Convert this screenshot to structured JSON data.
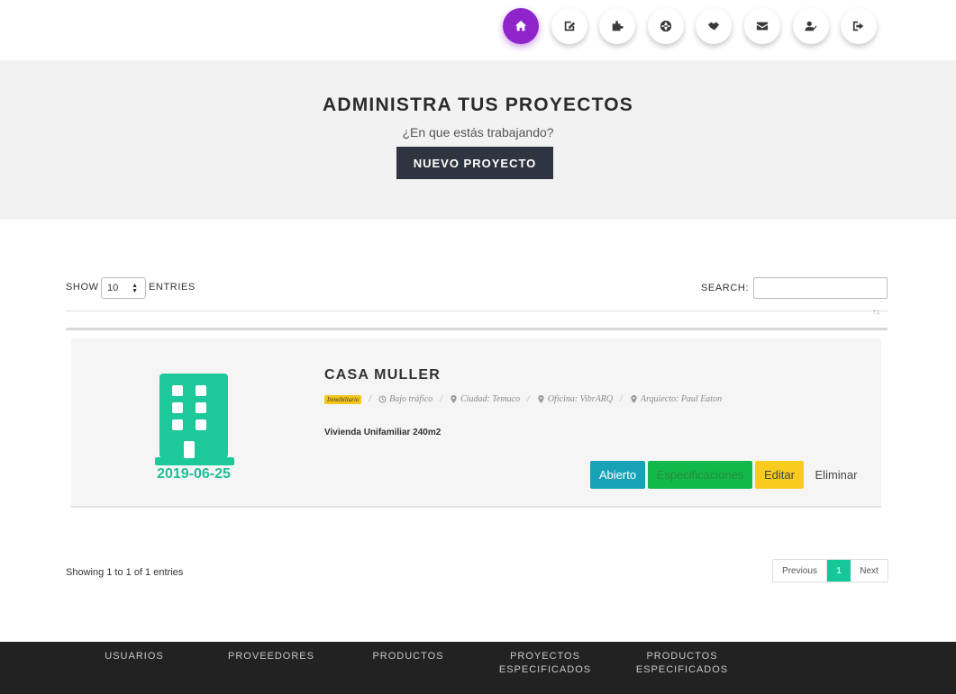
{
  "nav": {
    "icons": [
      "home-icon",
      "edit-icon",
      "puzzle-icon",
      "globe-icon",
      "handshake-icon",
      "envelope-icon",
      "user-check-icon",
      "sign-out-icon"
    ],
    "active_color": "#8e24c9"
  },
  "hero": {
    "title": "ADMINISTRA TUS PROYECTOS",
    "subtitle": "¿En que estás trabajando?",
    "button_label": "NUEVO PROYECTO"
  },
  "table": {
    "show_label": "SHOW",
    "entries_label": "ENTRIES",
    "page_length": "10",
    "search_label": "SEARCH:",
    "search_value": "",
    "sort_indicator": "↑↓"
  },
  "project": {
    "date": "2019-06-25",
    "title": "CASA MULLER",
    "category": "Inmobiliario",
    "traffic": "Bajo tráfico",
    "city": "Ciudad: Temuco",
    "office": "Oficina: VibrARQ",
    "architect": "Arquiecto: Paul Eaton",
    "description": "Vivienda Unifamiliar 240m2",
    "actions": {
      "open": "Abierto",
      "specs": "Especificaciones",
      "edit": "Editar",
      "delete": "Eliminar"
    },
    "icon_color": "#1bc99b"
  },
  "pagination": {
    "info": "Showing 1 to 1 of 1 entries",
    "previous": "Previous",
    "current": "1",
    "next": "Next"
  },
  "footer": {
    "links": [
      "USUARIOS",
      "PROVEEDORES",
      "PRODUCTOS",
      "PROYECTOS ESPECIFICADOS",
      "PRODUCTOS ESPECIFICADOS"
    ]
  },
  "separator": "/"
}
